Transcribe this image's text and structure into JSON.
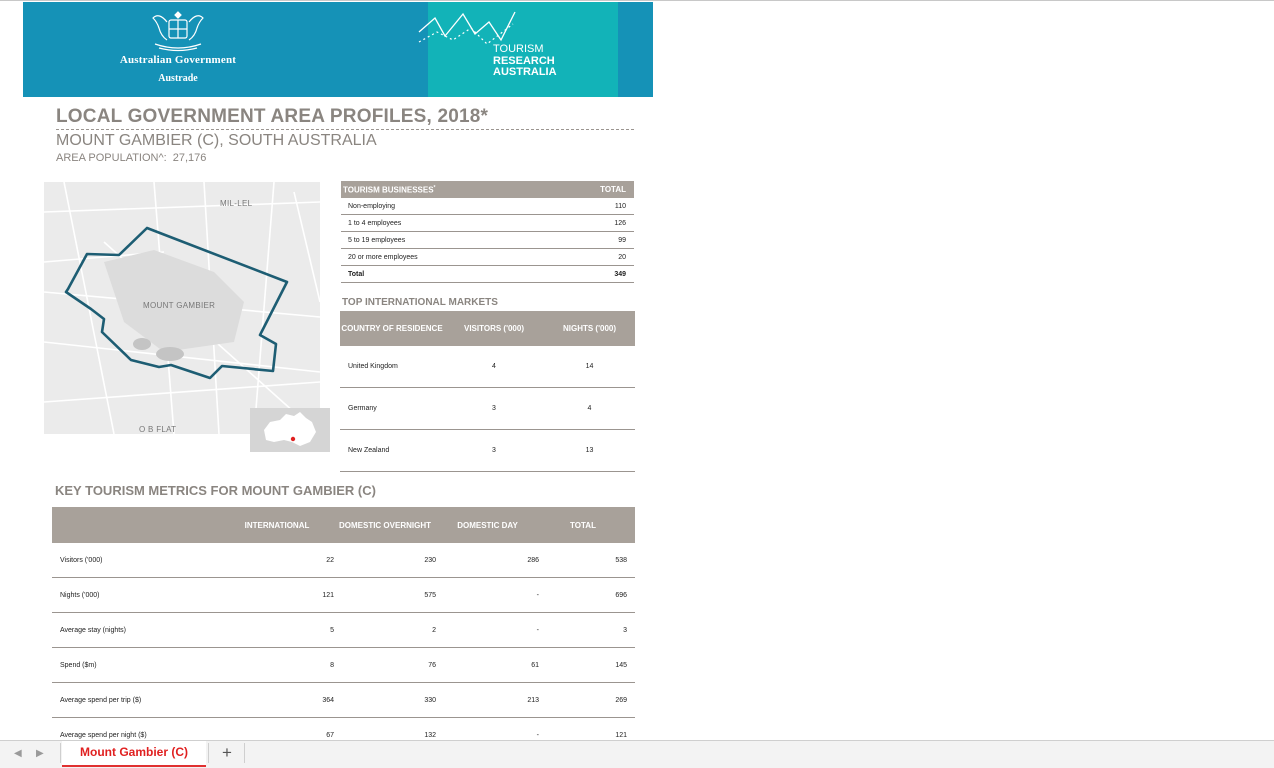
{
  "header": {
    "gov_name": "Australian Government",
    "gov_sub": "Austrade",
    "tra_line1": "TOURISM",
    "tra_line2": "RESEARCH",
    "tra_line3": "AUSTRALIA"
  },
  "title": "LOCAL GOVERNMENT AREA PROFILES, 2018*",
  "subtitle": "MOUNT GAMBIER (C), SOUTH AUSTRALIA",
  "population": {
    "label": "AREA POPULATION^:",
    "value": "27,176"
  },
  "map": {
    "labels": {
      "mil_lel": "MIL-LEL",
      "mount_gambier": "MOUNT GAMBIER",
      "ob_flat": "O B FLAT"
    }
  },
  "businesses": {
    "header": "TOURISM BUSINESSES",
    "header_mark": "*",
    "total_header": "TOTAL",
    "rows": [
      {
        "label": "Non-employing",
        "value": "110"
      },
      {
        "label": "1 to 4 employees",
        "value": "126"
      },
      {
        "label": "5 to 19 employees",
        "value": "99"
      },
      {
        "label": "20 or more employees",
        "value": "20"
      },
      {
        "label": "Total",
        "value": "349"
      }
    ]
  },
  "markets": {
    "section_title": "TOP INTERNATIONAL MARKETS",
    "headers": [
      "COUNTRY OF RESIDENCE",
      "VISITORS ('000)",
      "NIGHTS ('000)"
    ],
    "rows": [
      {
        "country": "United Kingdom",
        "visitors": "4",
        "nights": "14"
      },
      {
        "country": "Germany",
        "visitors": "3",
        "nights": "4"
      },
      {
        "country": "New Zealand",
        "visitors": "3",
        "nights": "13"
      }
    ]
  },
  "metrics": {
    "section_title": "KEY TOURISM METRICS FOR MOUNT GAMBIER (C)",
    "headers": [
      "INTERNATIONAL",
      "DOMESTIC OVERNIGHT",
      "DOMESTIC DAY",
      "TOTAL"
    ],
    "rows": [
      {
        "label": "Visitors ('000)",
        "values": [
          "22",
          "230",
          "286",
          "538"
        ]
      },
      {
        "label": "Nights ('000)",
        "values": [
          "121",
          "575",
          "-",
          "696"
        ]
      },
      {
        "label": "Average stay (nights)",
        "values": [
          "5",
          "2",
          "-",
          "3"
        ]
      },
      {
        "label": "Spend ($m)",
        "values": [
          "8",
          "76",
          "61",
          "145"
        ]
      },
      {
        "label": "Average spend per trip ($)",
        "values": [
          "364",
          "330",
          "213",
          "269"
        ]
      },
      {
        "label": "Average spend per night ($)",
        "values": [
          "67",
          "132",
          "-",
          "121"
        ]
      }
    ]
  },
  "sheet_tabs": {
    "active": "Mount Gambier (C)",
    "add": "+"
  },
  "colors": {
    "gov_blue": "#1592b7",
    "tra_teal": "#12b3b8",
    "table_header": "#a8a19a",
    "title_grey": "#8a8580",
    "tab_red": "#e02020"
  }
}
